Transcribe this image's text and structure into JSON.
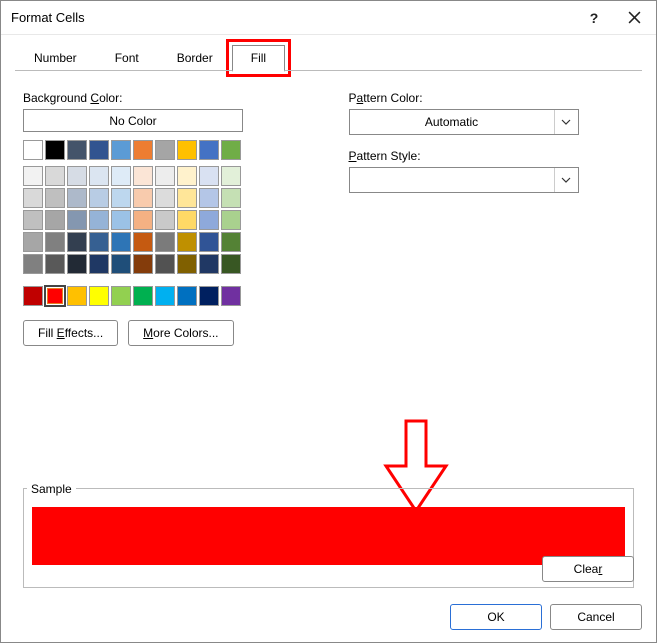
{
  "window": {
    "title": "Format Cells"
  },
  "tabs": {
    "number": "Number",
    "font": "Font",
    "border": "Border",
    "fill": "Fill"
  },
  "left": {
    "bg_label_pre": "Background ",
    "bg_label_key": "C",
    "bg_label_post": "olor:",
    "no_color": "No Color",
    "fill_effects_pre": "Fill ",
    "fill_effects_key": "E",
    "fill_effects_post": "ffects...",
    "more_colors_key": "M",
    "more_colors_post": "ore Colors..."
  },
  "right": {
    "pattern_color_pre": "P",
    "pattern_color_key": "a",
    "pattern_color_post": "ttern Color:",
    "automatic": "Automatic",
    "pattern_style_key": "P",
    "pattern_style_post": "attern Style:"
  },
  "sample": {
    "label": "Sample",
    "color": "#ff0000"
  },
  "footer": {
    "clear_pre": "Clea",
    "clear_key": "r",
    "ok": "OK",
    "cancel": "Cancel"
  },
  "accent_annotation": "#ff0000",
  "palette_row1": [
    "#ffffff",
    "#000000",
    "#44546a",
    "#325490",
    "#5b9bd5",
    "#ed7d31",
    "#a5a5a5",
    "#ffc000",
    "#4472c4",
    "#70ad47"
  ],
  "palette_block": [
    [
      "#f2f2f2",
      "#d9d9d9",
      "#d6dce5",
      "#dbe5f1",
      "#deebf7",
      "#fbe5d6",
      "#ededed",
      "#fff2cc",
      "#d9e1f2",
      "#e2f0d9"
    ],
    [
      "#d9d9d9",
      "#bfbfbf",
      "#adb9ca",
      "#b8cce4",
      "#bdd7ee",
      "#f8cbad",
      "#dcdcdc",
      "#ffe699",
      "#b4c6e7",
      "#c5e0b4"
    ],
    [
      "#bfbfbf",
      "#a6a6a6",
      "#8497b0",
      "#95b3d7",
      "#9bc2e6",
      "#f4b183",
      "#c9c9c9",
      "#ffd966",
      "#8ea9db",
      "#a9d18e"
    ],
    [
      "#a6a6a6",
      "#808080",
      "#333f50",
      "#366092",
      "#2e75b6",
      "#c55a11",
      "#7b7b7b",
      "#bf9000",
      "#305496",
      "#548235"
    ],
    [
      "#808080",
      "#595959",
      "#222a35",
      "#1f3864",
      "#1f4e79",
      "#843c0b",
      "#525252",
      "#806000",
      "#203864",
      "#385723"
    ]
  ],
  "standard_row": [
    "#c00000",
    "#ff0000",
    "#ffc000",
    "#ffff00",
    "#92d050",
    "#00b050",
    "#00b0f0",
    "#0070c0",
    "#002060",
    "#7030a0"
  ],
  "selected_standard_index": 1
}
